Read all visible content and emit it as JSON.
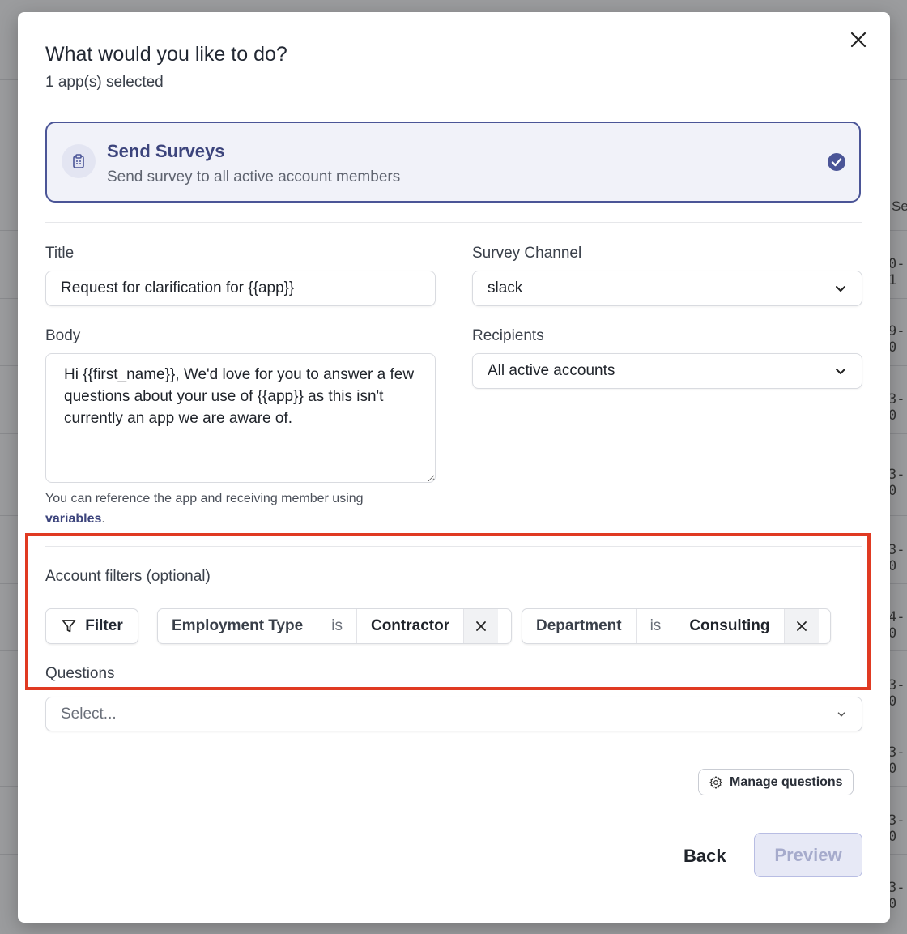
{
  "background": {
    "fragments": [
      "Se",
      "0-1",
      "9-0",
      "3-0",
      "3-0",
      "3-0",
      "4-0",
      "3-0",
      "3-0",
      "3-0",
      "3-0"
    ]
  },
  "modal": {
    "title": "What would you like to do?",
    "subtitle": "1 app(s) selected",
    "close_icon": "close-icon"
  },
  "action": {
    "icon": "clipboard-icon",
    "title": "Send Surveys",
    "description": "Send survey to all active account members",
    "selected": true
  },
  "form": {
    "title_label": "Title",
    "title_value": "Request for clarification for {{app}}",
    "channel_label": "Survey Channel",
    "channel_value": "slack",
    "body_label": "Body",
    "body_value": "Hi {{first_name}}, We'd love for you to answer a few questions about your use of {{app}} as this isn't currently an app we are aware of.",
    "recipients_label": "Recipients",
    "recipients_value": "All active accounts",
    "help_text": "You can reference the app and receiving member using",
    "help_link": "variables",
    "help_suffix": "."
  },
  "filters": {
    "label": "Account filters (optional)",
    "filter_button": "Filter",
    "chips": [
      {
        "field": "Employment Type",
        "operator": "is",
        "value": "Contractor"
      },
      {
        "field": "Department",
        "operator": "is",
        "value": "Consulting"
      }
    ]
  },
  "questions": {
    "label": "Questions",
    "placeholder": "Select..."
  },
  "buttons": {
    "manage": "Manage questions",
    "back": "Back",
    "preview": "Preview"
  },
  "colors": {
    "accent": "#4b5597",
    "highlight": "#e03a22"
  }
}
